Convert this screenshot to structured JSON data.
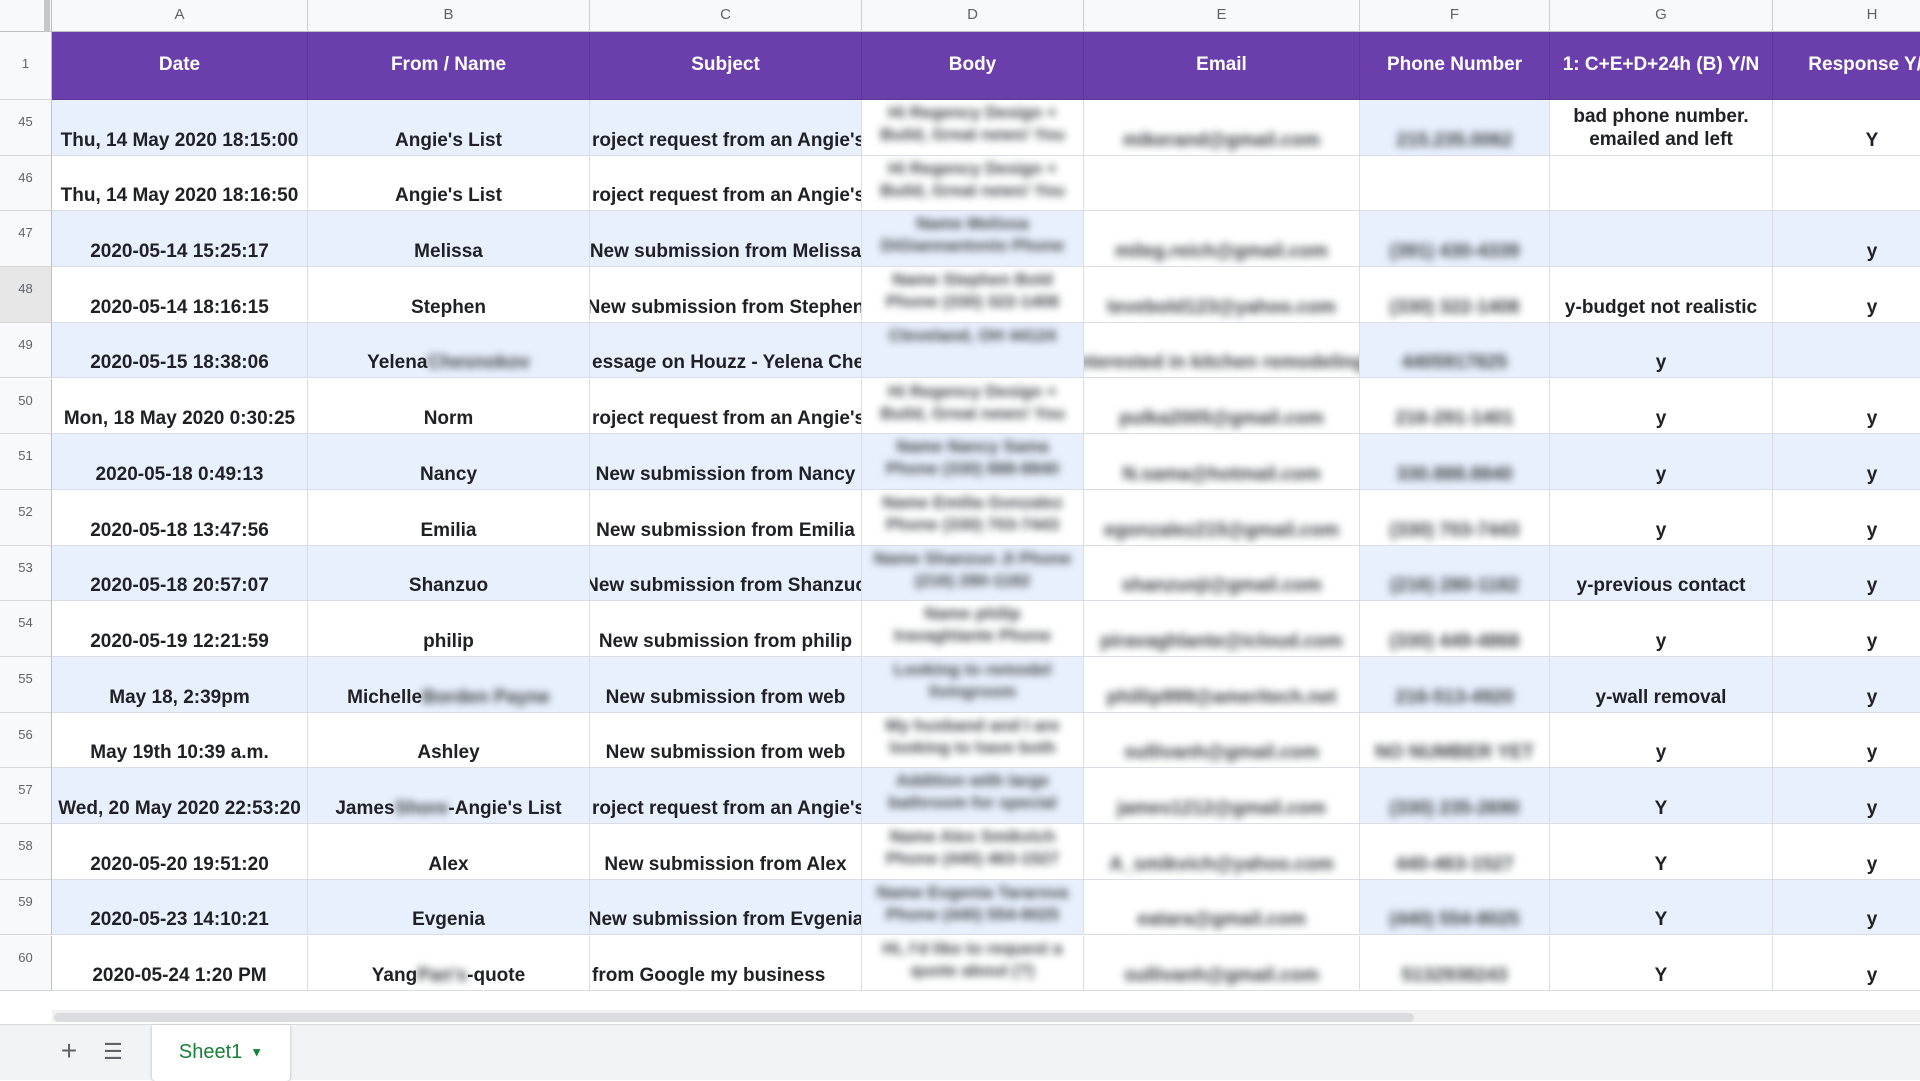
{
  "columns": [
    {
      "letter": "A",
      "header": "Date"
    },
    {
      "letter": "B",
      "header": "From / Name"
    },
    {
      "letter": "C",
      "header": "Subject"
    },
    {
      "letter": "D",
      "header": "Body"
    },
    {
      "letter": "E",
      "header": "Email"
    },
    {
      "letter": "F",
      "header": "Phone Number"
    },
    {
      "letter": "G",
      "header": "1: C+E+D+24h (B)  Y/N"
    },
    {
      "letter": "H",
      "header": "Response Y/N"
    }
  ],
  "header_row_number": "1",
  "rows": [
    {
      "num": "45",
      "date": "Thu, 14 May 2020 18:15:00",
      "name": "Angie's List",
      "name_blur": "",
      "name_suffix": "",
      "subject": "roject request from an Angie's l",
      "body": "Hi Regency Design + Build, Great news! You",
      "email": "mikerand@gmail.com",
      "phone": "215.235.0062",
      "g": "bad phone number. emailed and left",
      "h": "Y"
    },
    {
      "num": "46",
      "date": "Thu, 14 May 2020 18:16:50",
      "name": "Angie's List",
      "name_blur": "",
      "name_suffix": "",
      "subject": "roject request from an Angie's l",
      "body": "Hi Regency Design + Build, Great news! You",
      "email": "",
      "phone": "",
      "g": "",
      "h": ""
    },
    {
      "num": "47",
      "date": "2020-05-14 15:25:17",
      "name": "Melissa",
      "name_blur": "",
      "name_suffix": "",
      "subject": "New submission from Melissa",
      "body": "Name Melissa DiGiannantonio Phone",
      "email": "mileg.reich@gmail.com",
      "phone": "(391) 430-4339",
      "g": "",
      "h": "y"
    },
    {
      "num": "48",
      "date": "2020-05-14 18:16:15",
      "name": "Stephen",
      "name_blur": "",
      "name_suffix": "",
      "subject": "New submission from Stephen",
      "body": "Name Stephen Bold Phone (330) 322-1408",
      "email": "tevebold123@yahoo.com",
      "phone": "(330) 322-1408",
      "g": "y-budget not realistic",
      "h": "y"
    },
    {
      "num": "49",
      "date": "2020-05-15 18:38:06",
      "name": "Yelena ",
      "name_blur": "Chesnokov",
      "name_suffix": "",
      "subject": "essage on Houzz - Yelena Ches",
      "body": "Cleveland, OH 44124",
      "email": "nterested in kitchen remodeling",
      "phone": "4405917825",
      "g": "y",
      "h": ""
    },
    {
      "num": "50",
      "date": "Mon, 18 May 2020 0:30:25",
      "name": "Norm",
      "name_blur": "",
      "name_suffix": "",
      "subject": "roject request from an Angie's",
      "body": "Hi Regency Design + Build, Great news! You",
      "email": "pulka2005@gmail.com",
      "phone": "216-291-1401",
      "g": "y",
      "h": "y"
    },
    {
      "num": "51",
      "date": "2020-05-18 0:49:13",
      "name": "Nancy",
      "name_blur": "",
      "name_suffix": "",
      "subject": "New submission from Nancy",
      "body": "Name Nancy Sama Phone (330) 888-8840",
      "email": "N.sama@hotmail.com",
      "phone": "330.888.8840",
      "g": "y",
      "h": "y"
    },
    {
      "num": "52",
      "date": "2020-05-18 13:47:56",
      "name": "Emilia",
      "name_blur": "",
      "name_suffix": "",
      "subject": "New submission from Emilia",
      "body": "Name Emilia Gonzalez Phone (330) 703-7443",
      "email": "egonzalez215@gmail.com",
      "phone": "(330) 703-7443",
      "g": "y",
      "h": "y"
    },
    {
      "num": "53",
      "date": "2020-05-18 20:57:07",
      "name": "Shanzuo",
      "name_blur": "",
      "name_suffix": "",
      "subject": "New submission from Shanzuc",
      "body": "Name Shanzuo Ji Phone (216) 280-1182",
      "email": "shanzuoji@gmail.com",
      "phone": "(216) 280-1182",
      "g": "y-previous contact",
      "h": "y"
    },
    {
      "num": "54",
      "date": "2020-05-19 12:21:59",
      "name": "philip",
      "name_blur": "",
      "name_suffix": "",
      "subject": "New submission from philip",
      "body": "Name philip Iravaghlante Phone",
      "email": "piravaghlante@icloud.com",
      "phone": "(330) 449-4868",
      "g": "y",
      "h": "y"
    },
    {
      "num": "55",
      "date": "May 18, 2:39pm",
      "name": "Michelle ",
      "name_blur": "Borden Payne",
      "name_suffix": "",
      "subject": "New submission from web",
      "body": "Looking to remodel livingroom",
      "email": "phillip999@ameritech.net",
      "phone": "216-513-4920",
      "g": "y-wall removal",
      "h": "y"
    },
    {
      "num": "56",
      "date": "May 19th 10:39 a.m.",
      "name": "Ashley",
      "name_blur": "",
      "name_suffix": "",
      "subject": "New submission from web",
      "body": "My husband and I are looking to have both",
      "email": "sullivanh@gmail.com",
      "phone": "NO NUMBER YET",
      "g": "y",
      "h": "y"
    },
    {
      "num": "57",
      "date": "Wed, 20 May 2020 22:53:20",
      "name": "James ",
      "name_blur": "Shore",
      "name_suffix": "-Angie's List",
      "subject": "roject request from an Angie's",
      "body": "Addition with large bathroom for special",
      "email": "james1212@gmail.com",
      "phone": "(330) 235-2690",
      "g": "Y",
      "h": "y"
    },
    {
      "num": "58",
      "date": "2020-05-20 19:51:20",
      "name": "Alex",
      "name_blur": "",
      "name_suffix": "",
      "subject": "New submission from Alex",
      "body": "Name Alex Smikvich Phone (440) 463-1527",
      "email": "A_smikvich@yahoo.com",
      "phone": "440-463-1527",
      "g": "Y",
      "h": "y"
    },
    {
      "num": "59",
      "date": "2020-05-23 14:10:21",
      "name": "Evgenia",
      "name_blur": "",
      "name_suffix": "",
      "subject": "New submission from Evgenia",
      "body": "Name Evgenia Tararova Phone (440) 554-8025",
      "email": "eatara@gmail.com",
      "phone": "(440) 554-8025",
      "g": "Y",
      "h": "y"
    },
    {
      "num": "60",
      "date": "2020-05-24 1:20 PM",
      "name": "Yang ",
      "name_blur": "Pan's",
      "name_suffix": " -quote",
      "subject": "from Google my business",
      "body": "Hi, I'd like to request a quote about (?)",
      "email": "sullivanh@gmail.com",
      "phone": "5132938243",
      "g": "Y",
      "h": "y"
    }
  ],
  "sheet_tab": "Sheet1",
  "colors": {
    "header_bg": "#6a3fac",
    "band_bg": "#e8f0fe",
    "tab_text": "#188038"
  }
}
